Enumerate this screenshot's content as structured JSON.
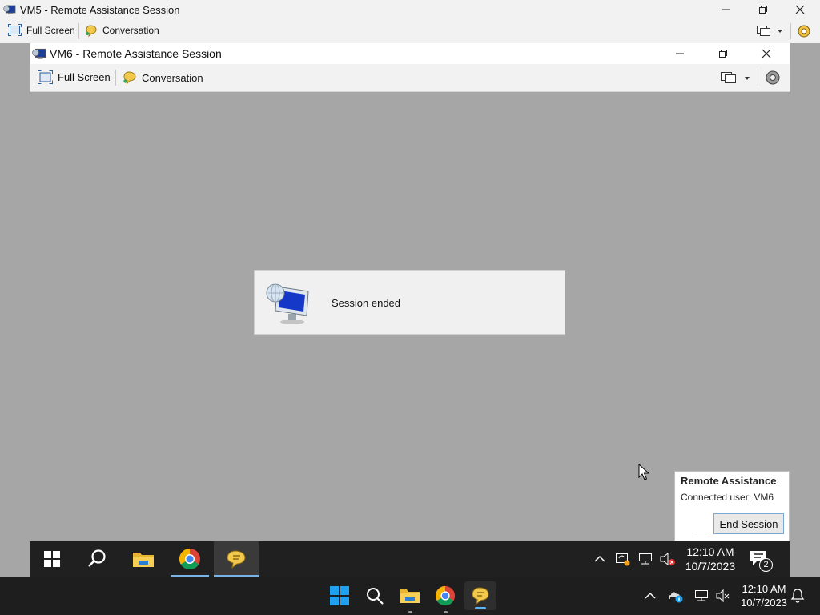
{
  "outer_window": {
    "title": "VM5 - Remote Assistance Session",
    "toolbar": {
      "full_screen": "Full Screen",
      "conversation": "Conversation"
    }
  },
  "inner_window": {
    "title": "VM6 - Remote Assistance Session",
    "toolbar": {
      "full_screen": "Full Screen",
      "conversation": "Conversation"
    }
  },
  "session_dialog": {
    "message": "Session ended"
  },
  "ra_popup": {
    "title": "Remote Assistance",
    "connected_user": "Connected user: VM6",
    "end_session_label": "End Session"
  },
  "inner_taskbar": {
    "time": "12:10 AM",
    "date": "10/7/2023",
    "notification_count": "2",
    "icons": [
      "windows-start-icon",
      "search-icon",
      "file-explorer-icon",
      "chrome-icon",
      "remote-assistance-icon"
    ]
  },
  "outer_taskbar": {
    "time": "12:10 AM",
    "date": "10/7/2023",
    "icons": [
      "windows-start-icon",
      "search-icon",
      "file-explorer-icon",
      "chrome-icon",
      "remote-assistance-icon"
    ]
  },
  "colors": {
    "desktop": "#a6a6a6",
    "taskbar_dark": "#1e1e1e",
    "accent_blue": "#0078d4",
    "win11_blue": "#1ea1f1"
  }
}
